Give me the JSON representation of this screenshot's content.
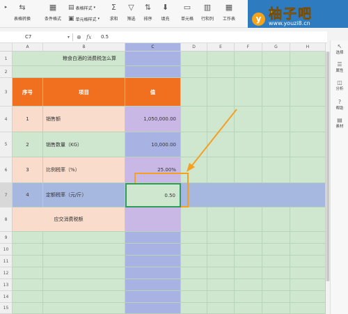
{
  "toolbar": {
    "items": [
      {
        "label": "表格转换",
        "icon": "table-convert-icon"
      },
      {
        "label": "条件格式",
        "icon": "conditional-format-icon"
      },
      {
        "label": "求和",
        "icon": "sum-icon"
      },
      {
        "label": "筛选",
        "icon": "filter-icon"
      },
      {
        "label": "排序",
        "icon": "sort-icon"
      },
      {
        "label": "填充",
        "icon": "fill-icon"
      },
      {
        "label": "单元格",
        "icon": "cell-icon"
      },
      {
        "label": "行和列",
        "icon": "row-column-icon"
      },
      {
        "label": "工作表",
        "icon": "worksheet-icon"
      }
    ],
    "row_items": [
      {
        "label": "表格样式",
        "icon": "table-style-icon"
      },
      {
        "label": "单元格样式",
        "icon": "cell-style-icon"
      }
    ]
  },
  "logo": {
    "title": "柚子吧",
    "url": "www.youzi8.cn",
    "badge": "y"
  },
  "formula_bar": {
    "cell_ref": "C7",
    "value": "0.5"
  },
  "columns": [
    "A",
    "B",
    "C",
    "D",
    "E",
    "F",
    "G",
    "H"
  ],
  "selected_column": "C",
  "rows": [
    "1",
    "2",
    "3",
    "4",
    "5",
    "6",
    "7",
    "8",
    "9",
    "10",
    "11",
    "12",
    "13",
    "14",
    "15"
  ],
  "selected_row": "7",
  "sheet": {
    "title": "粮食白酒的消费税怎么算",
    "headers": {
      "seq": "序号",
      "item": "项目",
      "value": "值"
    },
    "data": [
      {
        "seq": "1",
        "item": "销售额",
        "value": "1,050,000.00"
      },
      {
        "seq": "2",
        "item": "销售数量（KG）",
        "value": "10,000.00"
      },
      {
        "seq": "3",
        "item": "比例税率（%）",
        "value": "25.00%"
      },
      {
        "seq": "4",
        "item": "定额税率（元/斤）",
        "value": "0.50"
      }
    ],
    "result_label": "应交消费税额"
  },
  "right_panel": [
    {
      "label": "选择",
      "icon": "cursor-icon"
    },
    {
      "label": "属性",
      "icon": "properties-icon"
    },
    {
      "label": "分析",
      "icon": "analysis-icon"
    },
    {
      "label": "帮助",
      "icon": "help-icon"
    },
    {
      "label": "素材",
      "icon": "materials-icon"
    }
  ],
  "colors": {
    "header_orange": "#f07020",
    "value_column_blue": "#a9b3e3",
    "row_peach": "#f9dccb",
    "row_green": "#cfe6cf",
    "row_purple": "#c9b7e6",
    "selected_row_blue": "#a7b8e0",
    "annotation_orange": "#f5a020"
  }
}
